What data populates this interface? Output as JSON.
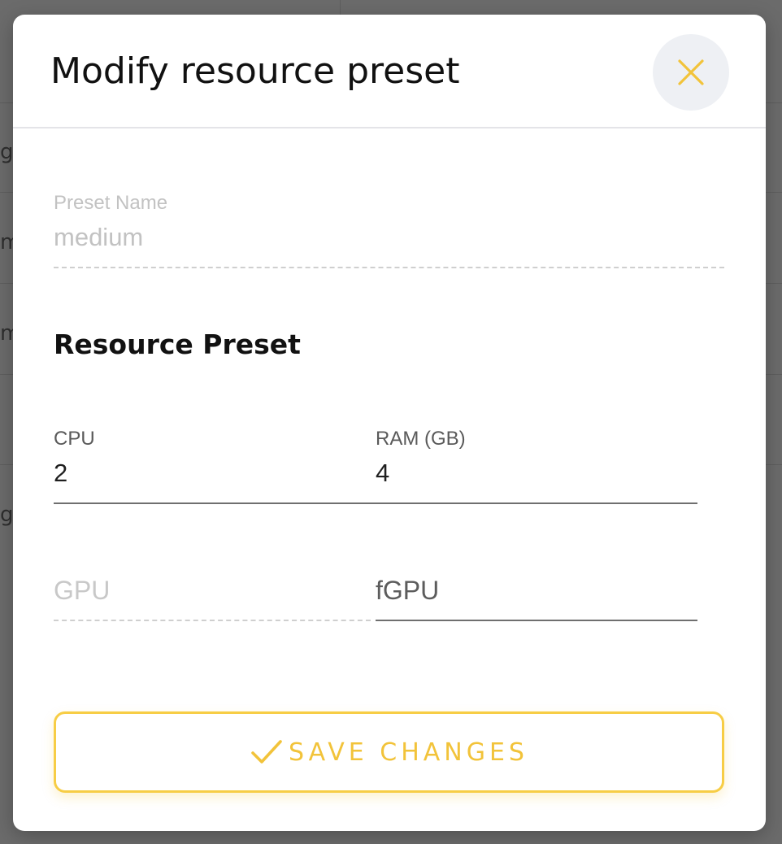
{
  "dialog": {
    "title": "Modify resource preset",
    "close_icon": "close-icon"
  },
  "preset_name": {
    "label": "Preset Name",
    "value": "medium"
  },
  "resource_section": {
    "heading": "Resource Preset"
  },
  "cpu": {
    "label": "CPU",
    "value": "2"
  },
  "ram": {
    "label": "RAM (GB)",
    "value": "4"
  },
  "gpu": {
    "placeholder": "GPU"
  },
  "fgpu": {
    "placeholder": "fGPU"
  },
  "save": {
    "label": "SAVE CHANGES",
    "icon": "check-icon"
  },
  "colors": {
    "accent": "#f7cd45",
    "background_overlay": "#6b6b6b"
  },
  "background_glyphs": [
    "g",
    "m",
    "m",
    "g"
  ]
}
